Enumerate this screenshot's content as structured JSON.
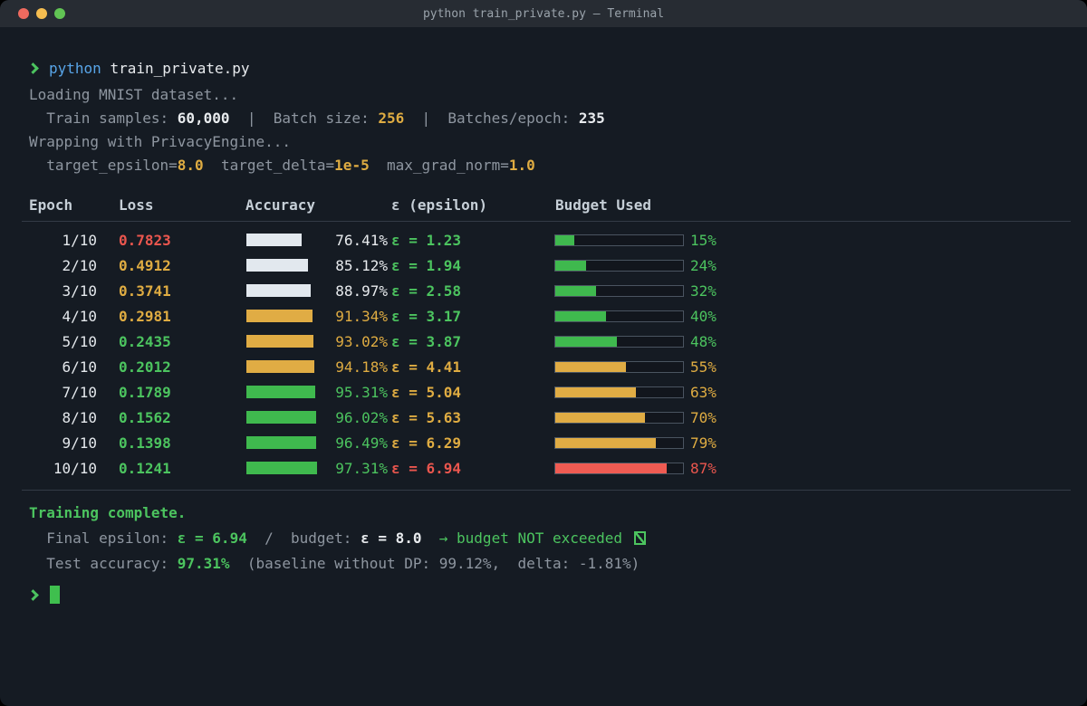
{
  "window": {
    "title": "python train_private.py — Terminal"
  },
  "colors": {
    "background": "#151b23",
    "titlebar": "#272c33",
    "green": "#4cc45f",
    "yellow": "#dfac42",
    "red": "#ea564e",
    "blue": "#58a5e8",
    "gray": "#8e96a0",
    "white": "#e8ebee",
    "bar_green": "#3fb94e",
    "bar_yellow": "#e0ac44",
    "bar_red": "#ef5b52",
    "bar_white": "#e2e8ee",
    "traffic_red": "#ee6a5f",
    "traffic_yellow": "#f5bd50",
    "traffic_green": "#61c454"
  },
  "prompt": {
    "symbol": "❯"
  },
  "command_line": [
    {
      "t": "python ",
      "c": "blue"
    },
    {
      "t": "train_private.py",
      "c": "white"
    }
  ],
  "output": {
    "loading": [
      {
        "t": "Loading MNIST dataset...",
        "c": "gray"
      }
    ],
    "samples": [
      {
        "t": "  Train samples: ",
        "c": "gray"
      },
      {
        "t": "60,000",
        "c": "white",
        "b": true
      },
      {
        "t": "  |  ",
        "c": "gray"
      },
      {
        "t": "Batch size: ",
        "c": "gray"
      },
      {
        "t": "256",
        "c": "yellow",
        "b": true
      },
      {
        "t": "  |  ",
        "c": "gray"
      },
      {
        "t": "Batches/epoch: ",
        "c": "gray"
      },
      {
        "t": "235",
        "c": "white",
        "b": true
      }
    ],
    "wrapping": [
      {
        "t": "Wrapping with PrivacyEngine...",
        "c": "gray"
      }
    ],
    "params": [
      {
        "t": "  target_epsilon=",
        "c": "gray"
      },
      {
        "t": "8.0",
        "c": "yellow",
        "b": true
      },
      {
        "t": "  target_delta=",
        "c": "gray"
      },
      {
        "t": "1e-5",
        "c": "yellow",
        "b": true
      },
      {
        "t": "  max_grad_norm=",
        "c": "gray"
      },
      {
        "t": "1.0",
        "c": "yellow",
        "b": true
      }
    ]
  },
  "table": {
    "headers": [
      "Epoch",
      "Loss",
      "Accuracy",
      "ε (epsilon)",
      "Budget Used"
    ],
    "rows": [
      {
        "epoch": "1/10",
        "loss": "0.7823",
        "loss_color": "red",
        "accuracy": 76.41,
        "accuracy_label": "76.41%",
        "acc_color": "white",
        "epsilon": "ε = 1.23",
        "eps_color": "green",
        "budget_pct": 15,
        "budget_label": "15%",
        "budget_color": "green"
      },
      {
        "epoch": "2/10",
        "loss": "0.4912",
        "loss_color": "yellow",
        "accuracy": 85.12,
        "accuracy_label": "85.12%",
        "acc_color": "white",
        "epsilon": "ε = 1.94",
        "eps_color": "green",
        "budget_pct": 24,
        "budget_label": "24%",
        "budget_color": "green"
      },
      {
        "epoch": "3/10",
        "loss": "0.3741",
        "loss_color": "yellow",
        "accuracy": 88.97,
        "accuracy_label": "88.97%",
        "acc_color": "white",
        "epsilon": "ε = 2.58",
        "eps_color": "green",
        "budget_pct": 32,
        "budget_label": "32%",
        "budget_color": "green"
      },
      {
        "epoch": "4/10",
        "loss": "0.2981",
        "loss_color": "yellow",
        "accuracy": 91.34,
        "accuracy_label": "91.34%",
        "acc_color": "yellow",
        "epsilon": "ε = 3.17",
        "eps_color": "green",
        "budget_pct": 40,
        "budget_label": "40%",
        "budget_color": "green"
      },
      {
        "epoch": "5/10",
        "loss": "0.2435",
        "loss_color": "green",
        "accuracy": 93.02,
        "accuracy_label": "93.02%",
        "acc_color": "yellow",
        "epsilon": "ε = 3.87",
        "eps_color": "green",
        "budget_pct": 48,
        "budget_label": "48%",
        "budget_color": "green"
      },
      {
        "epoch": "6/10",
        "loss": "0.2012",
        "loss_color": "green",
        "accuracy": 94.18,
        "accuracy_label": "94.18%",
        "acc_color": "yellow",
        "epsilon": "ε = 4.41",
        "eps_color": "yellow",
        "budget_pct": 55,
        "budget_label": "55%",
        "budget_color": "yellow"
      },
      {
        "epoch": "7/10",
        "loss": "0.1789",
        "loss_color": "green",
        "accuracy": 95.31,
        "accuracy_label": "95.31%",
        "acc_color": "green",
        "epsilon": "ε = 5.04",
        "eps_color": "yellow",
        "budget_pct": 63,
        "budget_label": "63%",
        "budget_color": "yellow"
      },
      {
        "epoch": "8/10",
        "loss": "0.1562",
        "loss_color": "green",
        "accuracy": 96.02,
        "accuracy_label": "96.02%",
        "acc_color": "green",
        "epsilon": "ε = 5.63",
        "eps_color": "yellow",
        "budget_pct": 70,
        "budget_label": "70%",
        "budget_color": "yellow"
      },
      {
        "epoch": "9/10",
        "loss": "0.1398",
        "loss_color": "green",
        "accuracy": 96.49,
        "accuracy_label": "96.49%",
        "acc_color": "green",
        "epsilon": "ε = 6.29",
        "eps_color": "yellow",
        "budget_pct": 79,
        "budget_label": "79%",
        "budget_color": "yellow"
      },
      {
        "epoch": "10/10",
        "loss": "0.1241",
        "loss_color": "green",
        "accuracy": 97.31,
        "accuracy_label": "97.31%",
        "acc_color": "green",
        "epsilon": "ε = 6.94",
        "eps_color": "red",
        "budget_pct": 87,
        "budget_label": "87%",
        "budget_color": "red"
      }
    ]
  },
  "summary": {
    "complete": [
      {
        "t": "Training complete.",
        "c": "green",
        "b": true
      }
    ],
    "final": [
      {
        "t": "  Final epsilon: ",
        "c": "gray"
      },
      {
        "t": "ε = 6.94",
        "c": "green",
        "b": true
      },
      {
        "t": "  /  ",
        "c": "gray"
      },
      {
        "t": "budget: ",
        "c": "gray"
      },
      {
        "t": "ε = 8.0",
        "c": "white",
        "b": true
      },
      {
        "t": "  ",
        "c": "gray"
      },
      {
        "t": "→ budget NOT exceeded ",
        "c": "green"
      }
    ],
    "final_check_glyph": "⧄",
    "test": [
      {
        "t": "  Test accuracy: ",
        "c": "gray"
      },
      {
        "t": "97.31%",
        "c": "green",
        "b": true
      },
      {
        "t": "  (baseline without DP: 99.12%,  delta: -1.81%)",
        "c": "gray"
      }
    ]
  }
}
